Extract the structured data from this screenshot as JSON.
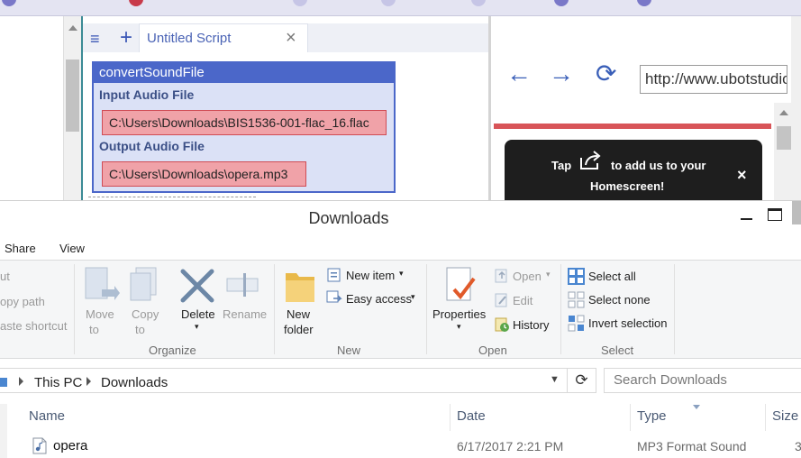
{
  "editor": {
    "tab_title": "Untitled Script",
    "tab_close": "×",
    "menu_glyph": "≡",
    "add_tab_glyph": "+",
    "block": {
      "title": "convertSoundFile",
      "input_label": "Input Audio File",
      "input_value": "C:\\Users\\Downloads\\BIS1536-001-flac_16.flac",
      "output_label": "Output Audio File",
      "output_value": "C:\\Users\\Downloads\\opera.mp3"
    }
  },
  "browser": {
    "back_glyph": "←",
    "forward_glyph": "→",
    "reload_glyph": "⟳",
    "url": "http://www.ubotstudio.com",
    "popup": {
      "line1_a": "Tap",
      "line1_b": "to add us to your",
      "line2": "Homescreen!",
      "close": "×",
      "icon": "share-icon"
    }
  },
  "explorer": {
    "title": "Downloads",
    "ribbon_tabs": [
      "Share",
      "View"
    ],
    "clipboard_partial": [
      "ut",
      "opy path",
      "aste shortcut"
    ],
    "organize": {
      "label": "Organize",
      "move_to": [
        "Move",
        "to"
      ],
      "copy_to": [
        "Copy",
        "to"
      ],
      "delete": "Delete",
      "rename": "Rename"
    },
    "new": {
      "label": "New",
      "new_folder": [
        "New",
        "folder"
      ],
      "new_item": "New item",
      "easy_access": "Easy access"
    },
    "open": {
      "label": "Open",
      "properties": "Properties",
      "open": "Open",
      "edit": "Edit",
      "history": "History"
    },
    "select": {
      "label": "Select",
      "select_all": "Select all",
      "select_none": "Select none",
      "invert_selection": "Invert selection"
    },
    "breadcrumb": [
      "This PC",
      "Downloads"
    ],
    "search_placeholder": "Search Downloads",
    "columns": [
      "Name",
      "Date",
      "Type",
      "Size"
    ],
    "files": [
      {
        "name": "opera",
        "date": "6/17/2017 2:21 PM",
        "type": "MP3 Format Sound",
        "size": "3"
      }
    ]
  },
  "colors": {
    "accent_blue": "#4b67c9",
    "field_pink": "#f0a2a8",
    "popup_bg": "#1e1e1e",
    "browser_red": "#d85458"
  }
}
